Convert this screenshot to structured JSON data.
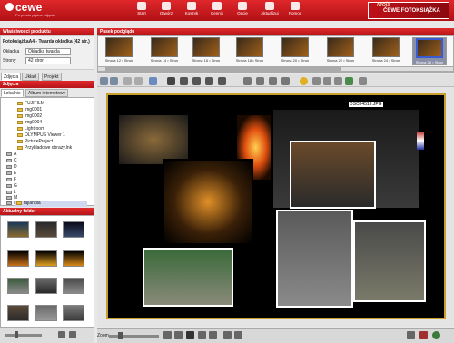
{
  "app": {
    "logo": "cewe",
    "logo_tagline": "Po prostu piękne zdjęcia",
    "brand_moja": "Moja",
    "brand_title": "CEWE FOTOKSIĄŻKA"
  },
  "toolbar_top": [
    {
      "label": "Start",
      "icon": "home-icon"
    },
    {
      "label": "Otwórz",
      "icon": "open-icon"
    },
    {
      "label": "Koszyk",
      "icon": "cart-icon"
    },
    {
      "label": "Cennik",
      "icon": "price-icon"
    },
    {
      "label": "Opcje",
      "icon": "gear-icon"
    },
    {
      "label": "Aktualizuj",
      "icon": "update-icon"
    },
    {
      "label": "Pomoc",
      "icon": "help-icon"
    }
  ],
  "props": {
    "head": "Właściwości produktu",
    "product": "FotoksiążkaA4 - Twarda okładka (42 str.)",
    "cover_label": "Okładka",
    "cover_value": "Okładka twarda",
    "pages_label": "Strony",
    "pages_value": "42 stron"
  },
  "tabs1": [
    "Zdjęcia",
    "Układ",
    "Projekt"
  ],
  "photos_head": "Zdjęcia",
  "tabs2": [
    "Lokalnie",
    "Album internetowy"
  ],
  "tree": [
    {
      "label": "FUJIFILM",
      "type": "folder"
    },
    {
      "label": "img0001",
      "type": "folder"
    },
    {
      "label": "img0002",
      "type": "folder"
    },
    {
      "label": "img0004",
      "type": "folder"
    },
    {
      "label": "Lightroom",
      "type": "folder"
    },
    {
      "label": "OLYMPUS Viewer 1",
      "type": "folder"
    },
    {
      "label": "PictureProject",
      "type": "folder"
    },
    {
      "label": "Przykładowe obrazy.lnk",
      "type": "folder"
    },
    {
      "label": "A",
      "type": "drive"
    },
    {
      "label": "C",
      "type": "drive"
    },
    {
      "label": "D",
      "type": "drive"
    },
    {
      "label": "E",
      "type": "drive"
    },
    {
      "label": "F",
      "type": "drive"
    },
    {
      "label": "G",
      "type": "drive"
    },
    {
      "label": "L",
      "type": "drive"
    },
    {
      "label": "M",
      "type": "drive"
    },
    {
      "label": "N",
      "type": "drive"
    },
    {
      "label": "tajlandia",
      "type": "folder"
    }
  ],
  "current_folder_head": "Aktualny folder",
  "film_head": "Pasek podglądu",
  "film": [
    {
      "caption": "Strona 12 • Stron"
    },
    {
      "caption": "Strona 14 • Stron"
    },
    {
      "caption": "Strona 16 • Stron"
    },
    {
      "caption": "Strona 18 • Stron"
    },
    {
      "caption": "Strona 20 • Stron"
    },
    {
      "caption": "Strona 22 • Stron"
    },
    {
      "caption": "Strona 24 • Stron"
    },
    {
      "caption": "Strona 26 • Stron",
      "selected": true
    }
  ],
  "canvas": {
    "filename": "DSC04519.JPG"
  },
  "bottom": {
    "zoom_label": "Zoom"
  },
  "colors": {
    "accent_red": "#c8181c",
    "page_border": "#c8a030"
  }
}
